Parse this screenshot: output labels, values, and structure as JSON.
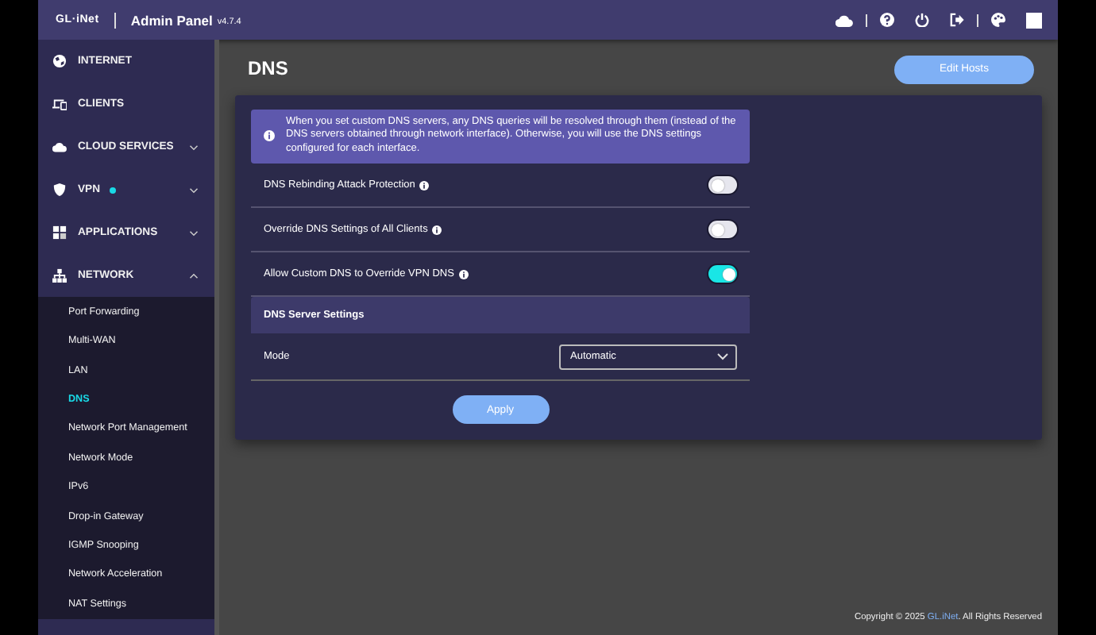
{
  "header": {
    "logo": "GL·iNet",
    "title": "Admin Panel",
    "version": "v4.7.4"
  },
  "sidebar": {
    "items": [
      {
        "label": "INTERNET",
        "expandable": false,
        "dot": false
      },
      {
        "label": "CLIENTS",
        "expandable": false,
        "dot": false
      },
      {
        "label": "CLOUD SERVICES",
        "expandable": true,
        "expanded": false,
        "dot": false
      },
      {
        "label": "VPN",
        "expandable": true,
        "expanded": false,
        "dot": true
      },
      {
        "label": "APPLICATIONS",
        "expandable": true,
        "expanded": false,
        "dot": false
      },
      {
        "label": "NETWORK",
        "expandable": true,
        "expanded": true,
        "dot": false,
        "children": [
          {
            "label": "Port Forwarding",
            "selected": false
          },
          {
            "label": "Multi-WAN",
            "selected": false
          },
          {
            "label": "LAN",
            "selected": false
          },
          {
            "label": "DNS",
            "selected": true
          },
          {
            "label": "Network Port Management",
            "selected": false
          },
          {
            "label": "Network Mode",
            "selected": false
          },
          {
            "label": "IPv6",
            "selected": false
          },
          {
            "label": "Drop-in Gateway",
            "selected": false
          },
          {
            "label": "IGMP Snooping",
            "selected": false
          },
          {
            "label": "Network Acceleration",
            "selected": false
          },
          {
            "label": "NAT Settings",
            "selected": false
          }
        ]
      }
    ]
  },
  "page": {
    "title": "DNS",
    "edit_button": "Edit Hosts",
    "info": "When you set custom DNS servers, any DNS queries will be resolved through them (instead of the DNS servers obtained through network interface). Otherwise, you will use the DNS settings configured for each interface.",
    "toggles": [
      {
        "label": "DNS Rebinding Attack Protection",
        "on": false
      },
      {
        "label": "Override DNS Settings of All Clients",
        "on": false
      },
      {
        "label": "Allow Custom DNS to Override VPN DNS",
        "on": true
      }
    ],
    "section_title": "DNS Server Settings",
    "mode": {
      "label": "Mode",
      "value": "Automatic"
    },
    "apply_button": "Apply"
  },
  "footer": {
    "prefix": "Copyright © 2025 ",
    "link": "GL.iNet",
    "suffix": ". All Rights Reserved"
  }
}
